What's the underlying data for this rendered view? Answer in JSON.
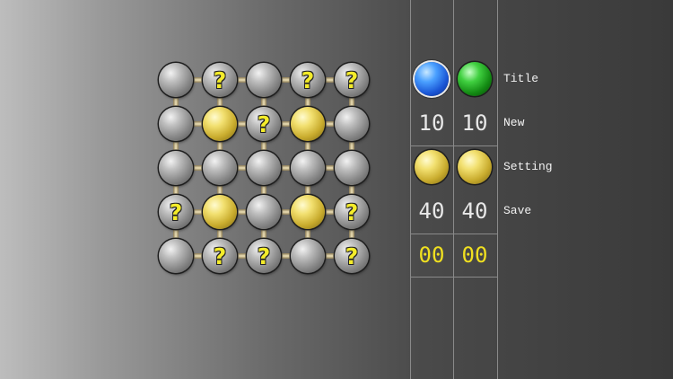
{
  "board": {
    "rows": [
      [
        "gray",
        "gray-q",
        "gray",
        "gray-q",
        "gray-q"
      ],
      [
        "gray",
        "yellow",
        "gray-q",
        "yellow",
        "gray"
      ],
      [
        "gray",
        "gray",
        "gray",
        "gray",
        "gray"
      ],
      [
        "gray-q",
        "yellow",
        "gray",
        "yellow",
        "gray-q"
      ],
      [
        "gray",
        "gray-q",
        "gray-q",
        "gray",
        "gray-q"
      ]
    ],
    "question_mark": "?"
  },
  "panel": {
    "players": [
      {
        "color": "blue",
        "moves": "10",
        "score": "40",
        "time": "00"
      },
      {
        "color": "green",
        "moves": "10",
        "score": "40",
        "time": "00"
      }
    ],
    "colors": {
      "blue": "#1a56d6",
      "green": "#138a13",
      "yellow": "#c9ac2e",
      "timer": "#f0e020"
    }
  },
  "menu": {
    "title": "Title",
    "new": "New",
    "setting": "Setting",
    "save": "Save"
  }
}
